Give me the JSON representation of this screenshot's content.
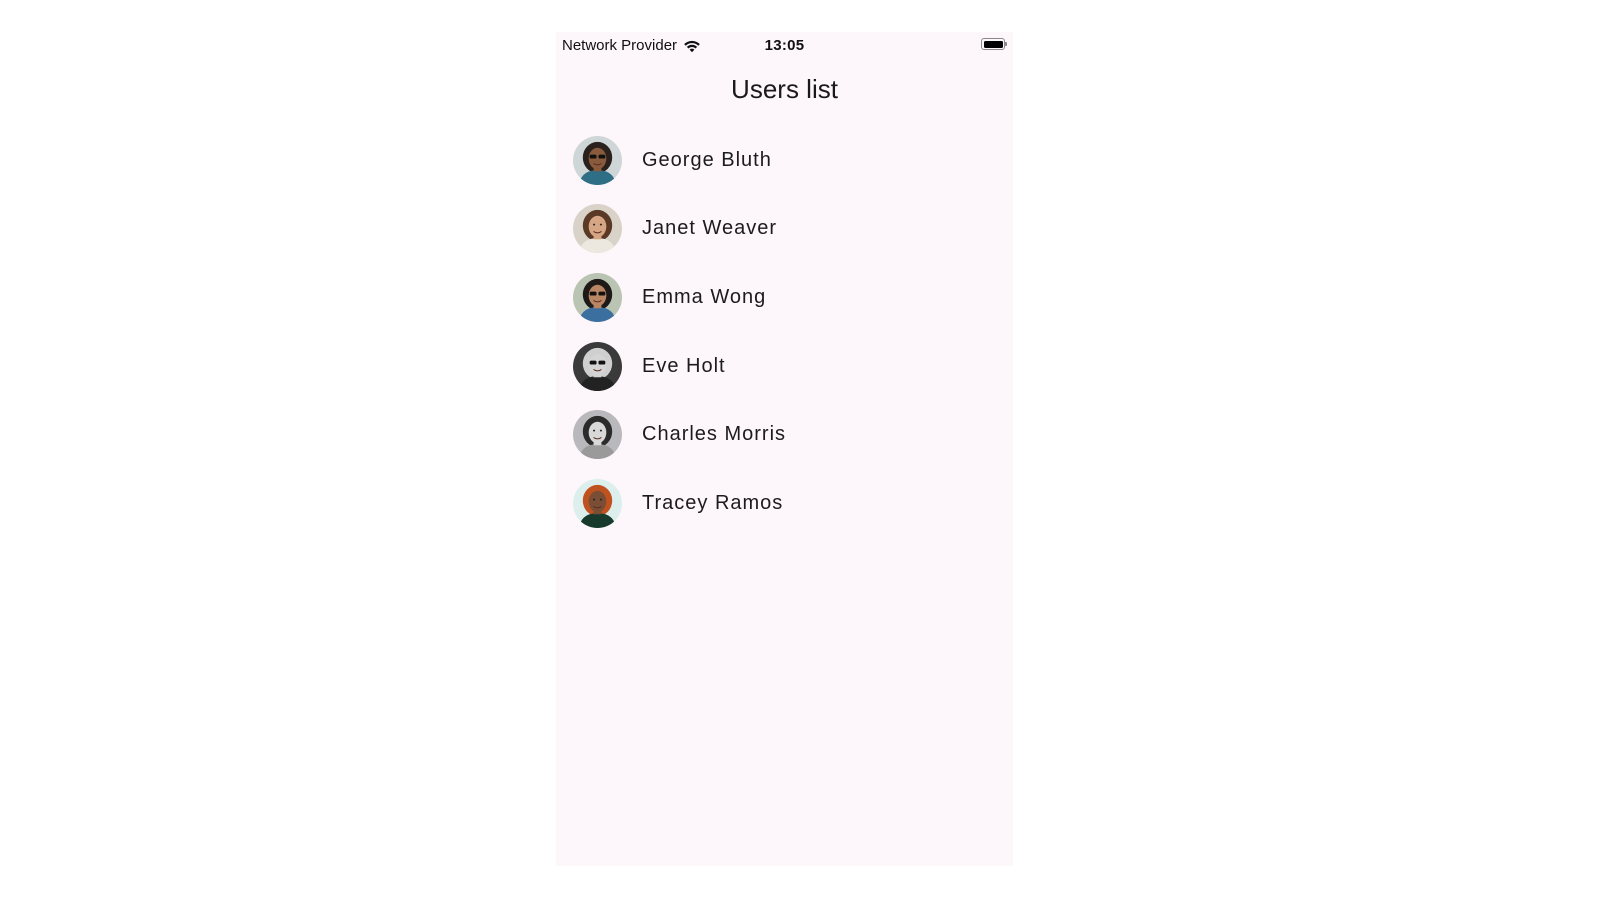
{
  "status_bar": {
    "carrier": "Network Provider",
    "wifi_icon": "wifi-icon",
    "time": "13:05",
    "battery_icon": "battery-full-icon",
    "battery_level": 1.0
  },
  "header": {
    "title": "Users list"
  },
  "users": [
    {
      "name": "George Bluth",
      "avatar": {
        "bg": "#cfd6d8",
        "skin": "#8a5a3c",
        "hair": "#2a211c",
        "shirt": "#2e6f86",
        "glasses": true
      }
    },
    {
      "name": "Janet Weaver",
      "avatar": {
        "bg": "#d9d2c8",
        "skin": "#d6a584",
        "hair": "#5a3a26",
        "shirt": "#ece8e0",
        "glasses": false
      }
    },
    {
      "name": "Emma Wong",
      "avatar": {
        "bg": "#b9c4b2",
        "skin": "#b98563",
        "hair": "#1e1a18",
        "shirt": "#3b6fa0",
        "glasses": true
      }
    },
    {
      "name": "Eve Holt",
      "avatar": {
        "bg": "#3a3a3a",
        "skin": "#d4d4d4",
        "hair": "#cfcfcf",
        "shirt": "#222222",
        "glasses": true
      }
    },
    {
      "name": "Charles Morris",
      "avatar": {
        "bg": "#b9b9bd",
        "skin": "#d8d8d8",
        "hair": "#2b2b2b",
        "shirt": "#9a9a9a",
        "glasses": false
      }
    },
    {
      "name": "Tracey Ramos",
      "avatar": {
        "bg": "#dcefed",
        "skin": "#7a4e34",
        "hair": "#c0521f",
        "shirt": "#173a2c",
        "glasses": false
      }
    }
  ]
}
